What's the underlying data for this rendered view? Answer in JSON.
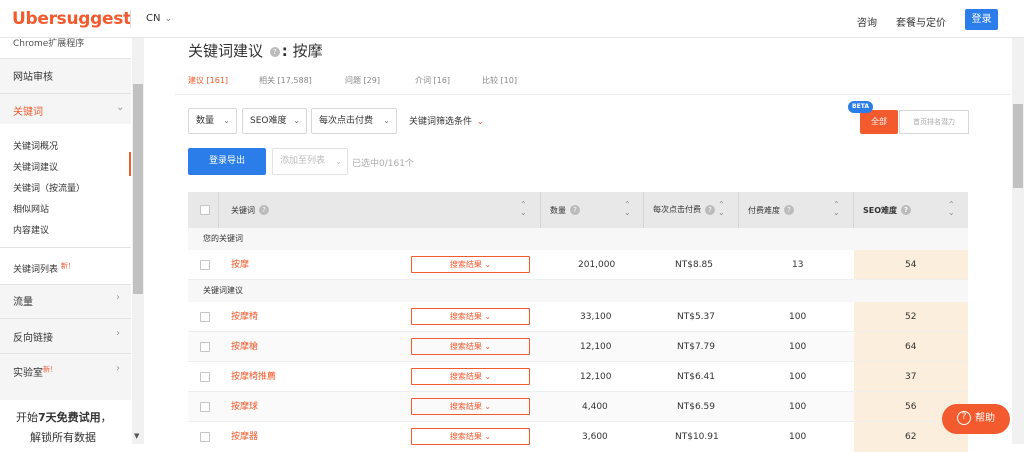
{
  "header": {
    "logo": "Ubersuggest",
    "country": "CN",
    "links": [
      "咨询",
      "套餐与定价"
    ],
    "login": "登录"
  },
  "sidebar": {
    "top_cut": "Chrome扩展程序",
    "site_audit": "网站审核",
    "keywords": "关键词",
    "sub_items": [
      "关键词概况",
      "关键词建议",
      "关键词（按流量）",
      "相似网站",
      "内容建议"
    ],
    "keyword_lists": "关键词列表",
    "new_tag": "新！",
    "traffic": "流量",
    "backlinks": "反向链接",
    "labs": "实验室",
    "trial_line1_a": "开始",
    "trial_line1_b": "7天免费试用",
    "trial_line1_c": "，",
    "trial_line2": "解锁所有数据"
  },
  "main": {
    "title_prefix": "关键词建议",
    "title_colon": ":",
    "title_keyword": "按摩",
    "tabs": [
      {
        "label": "建议 [161]",
        "active": true
      },
      {
        "label": "相关 [17,588]",
        "active": false
      },
      {
        "label": "问题 [29]",
        "active": false
      },
      {
        "label": "介词 [16]",
        "active": false
      },
      {
        "label": "比较 [10]",
        "active": false
      }
    ],
    "filters": [
      "数量",
      "SEO难度",
      "每次点击付费"
    ],
    "filter_conditions": "关键词筛选条件",
    "beta": "BETA",
    "all": "全部",
    "rank_potential": "首页排名潜力",
    "export": "登录导出",
    "add_to_list": "添加至列表",
    "selected": "已选中0/161个"
  },
  "table": {
    "headers": {
      "keyword": "关键词",
      "volume": "数量",
      "cpc": "每次点击付费",
      "paid": "付费难度",
      "seo": "SEO难度"
    },
    "section_yours": "您的关键词",
    "section_suggestions": "关键词建议",
    "serp_label": "搜索结果",
    "your_row": {
      "keyword": "按摩",
      "volume": "201,000",
      "cpc": "NT$8.85",
      "paid": "13",
      "seo": "54"
    },
    "rows": [
      {
        "keyword": "按摩椅",
        "volume": "33,100",
        "cpc": "NT$5.37",
        "paid": "100",
        "seo": "52"
      },
      {
        "keyword": "按摩槍",
        "volume": "12,100",
        "cpc": "NT$7.79",
        "paid": "100",
        "seo": "64"
      },
      {
        "keyword": "按摩椅推薦",
        "volume": "12,100",
        "cpc": "NT$6.41",
        "paid": "100",
        "seo": "37"
      },
      {
        "keyword": "按摩球",
        "volume": "4,400",
        "cpc": "NT$6.59",
        "paid": "100",
        "seo": "56"
      },
      {
        "keyword": "按摩器",
        "volume": "3,600",
        "cpc": "NT$10.91",
        "paid": "100",
        "seo": "62"
      }
    ]
  },
  "help": "帮助",
  "colors": {
    "accent": "#f35a2e",
    "primary": "#2b7de9",
    "seo_bg": "#fbeedd"
  }
}
